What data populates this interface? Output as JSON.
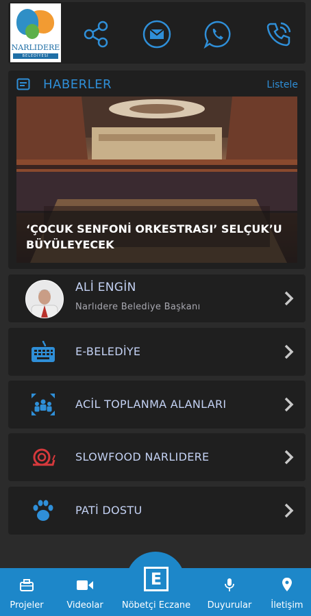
{
  "logo": {
    "name": "NARLIDERE",
    "subtitle": "BELEDİYESİ"
  },
  "top_icons": [
    "share-icon",
    "mail-icon",
    "whatsapp-icon",
    "phone-icon"
  ],
  "news": {
    "title": "HABERLER",
    "list_link": "Listele",
    "headline": "‘ÇOCUK SENFONİ ORKESTRASI’ SELÇUK’U BÜYÜLEYECEK"
  },
  "menu": [
    {
      "title": "ALİ ENGİN",
      "subtitle": "Narlıdere Belediye Başkanı",
      "icon": "avatar"
    },
    {
      "title": "E-BELEDİYE",
      "icon": "keyboard-icon"
    },
    {
      "title": "ACİL TOPLANMA ALANLARI",
      "icon": "assembly-icon"
    },
    {
      "title": "SLOWFOOD NARLIDERE",
      "icon": "snail-icon"
    },
    {
      "title": "PATİ DOSTU",
      "icon": "paw-icon"
    }
  ],
  "bottom_nav": [
    {
      "label": "Projeler",
      "icon": "briefcase-icon"
    },
    {
      "label": "Videolar",
      "icon": "video-icon"
    },
    {
      "label": "Nöbetçi Eczane",
      "icon": "pharmacy-icon",
      "glyph": "E"
    },
    {
      "label": "Duyurular",
      "icon": "microphone-icon"
    },
    {
      "label": "İletişim",
      "icon": "location-icon"
    }
  ],
  "colors": {
    "accent": "#2f8fd8",
    "bottom_bar": "#1d87c9",
    "card": "#1f1f1f",
    "background": "#2b2b2b",
    "snail": "#d6393c"
  }
}
